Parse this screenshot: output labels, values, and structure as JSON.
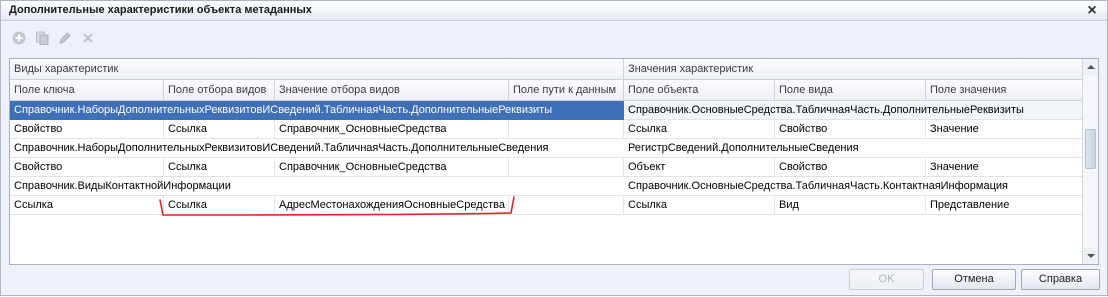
{
  "window": {
    "title": "Дополнительные характеристики объекта метаданных",
    "close_label": "×"
  },
  "toolbar": {
    "icons": [
      "add-icon",
      "copy-icon",
      "edit-icon",
      "delete-icon"
    ]
  },
  "groups": {
    "left": "Виды характеристик",
    "right": "Значения характеристик"
  },
  "columns": [
    "Поле ключа",
    "Поле отбора видов",
    "Значение отбора видов",
    "Поле пути к данным",
    "Поле объекта",
    "Поле вида",
    "Поле значения"
  ],
  "rows": [
    {
      "left_span": "Справочник.НаборыДополнительныхРеквизитовИСведений.ТабличнаяЧасть.ДополнительныеРеквизиты",
      "right_span": "Справочник.ОсновныеСредства.ТабличнаяЧасть.ДополнительныеРеквизиты"
    },
    {
      "cells": [
        "Свойство",
        "Ссылка",
        "Справочник_ОсновныеСредства",
        "",
        "Ссылка",
        "Свойство",
        "Значение"
      ]
    },
    {
      "left_span": "Справочник.НаборыДополнительныхРеквизитовИСведений.ТабличнаяЧасть.ДополнительныеСведения",
      "right_span": "РегистрСведений.ДополнительныеСведения"
    },
    {
      "cells": [
        "Свойство",
        "Ссылка",
        "Справочник_ОсновныеСредства",
        "",
        "Объект",
        "Свойство",
        "Значение"
      ]
    },
    {
      "left_span": "Справочник.ВидыКонтактнойИнформации",
      "right_span": "Справочник.ОсновныеСредства.ТабличнаяЧасть.КонтактнаяИнформация"
    },
    {
      "cells": [
        "Ссылка",
        "Ссылка",
        "АдресМестонахожденияОсновныеСредства",
        "",
        "Ссылка",
        "Вид",
        "Представление"
      ]
    }
  ],
  "buttons": {
    "ok": "OK",
    "cancel": "Отмена",
    "help": "Справка"
  },
  "colors": {
    "selection": "#3f6fb6",
    "annotation": "#e8232d"
  }
}
